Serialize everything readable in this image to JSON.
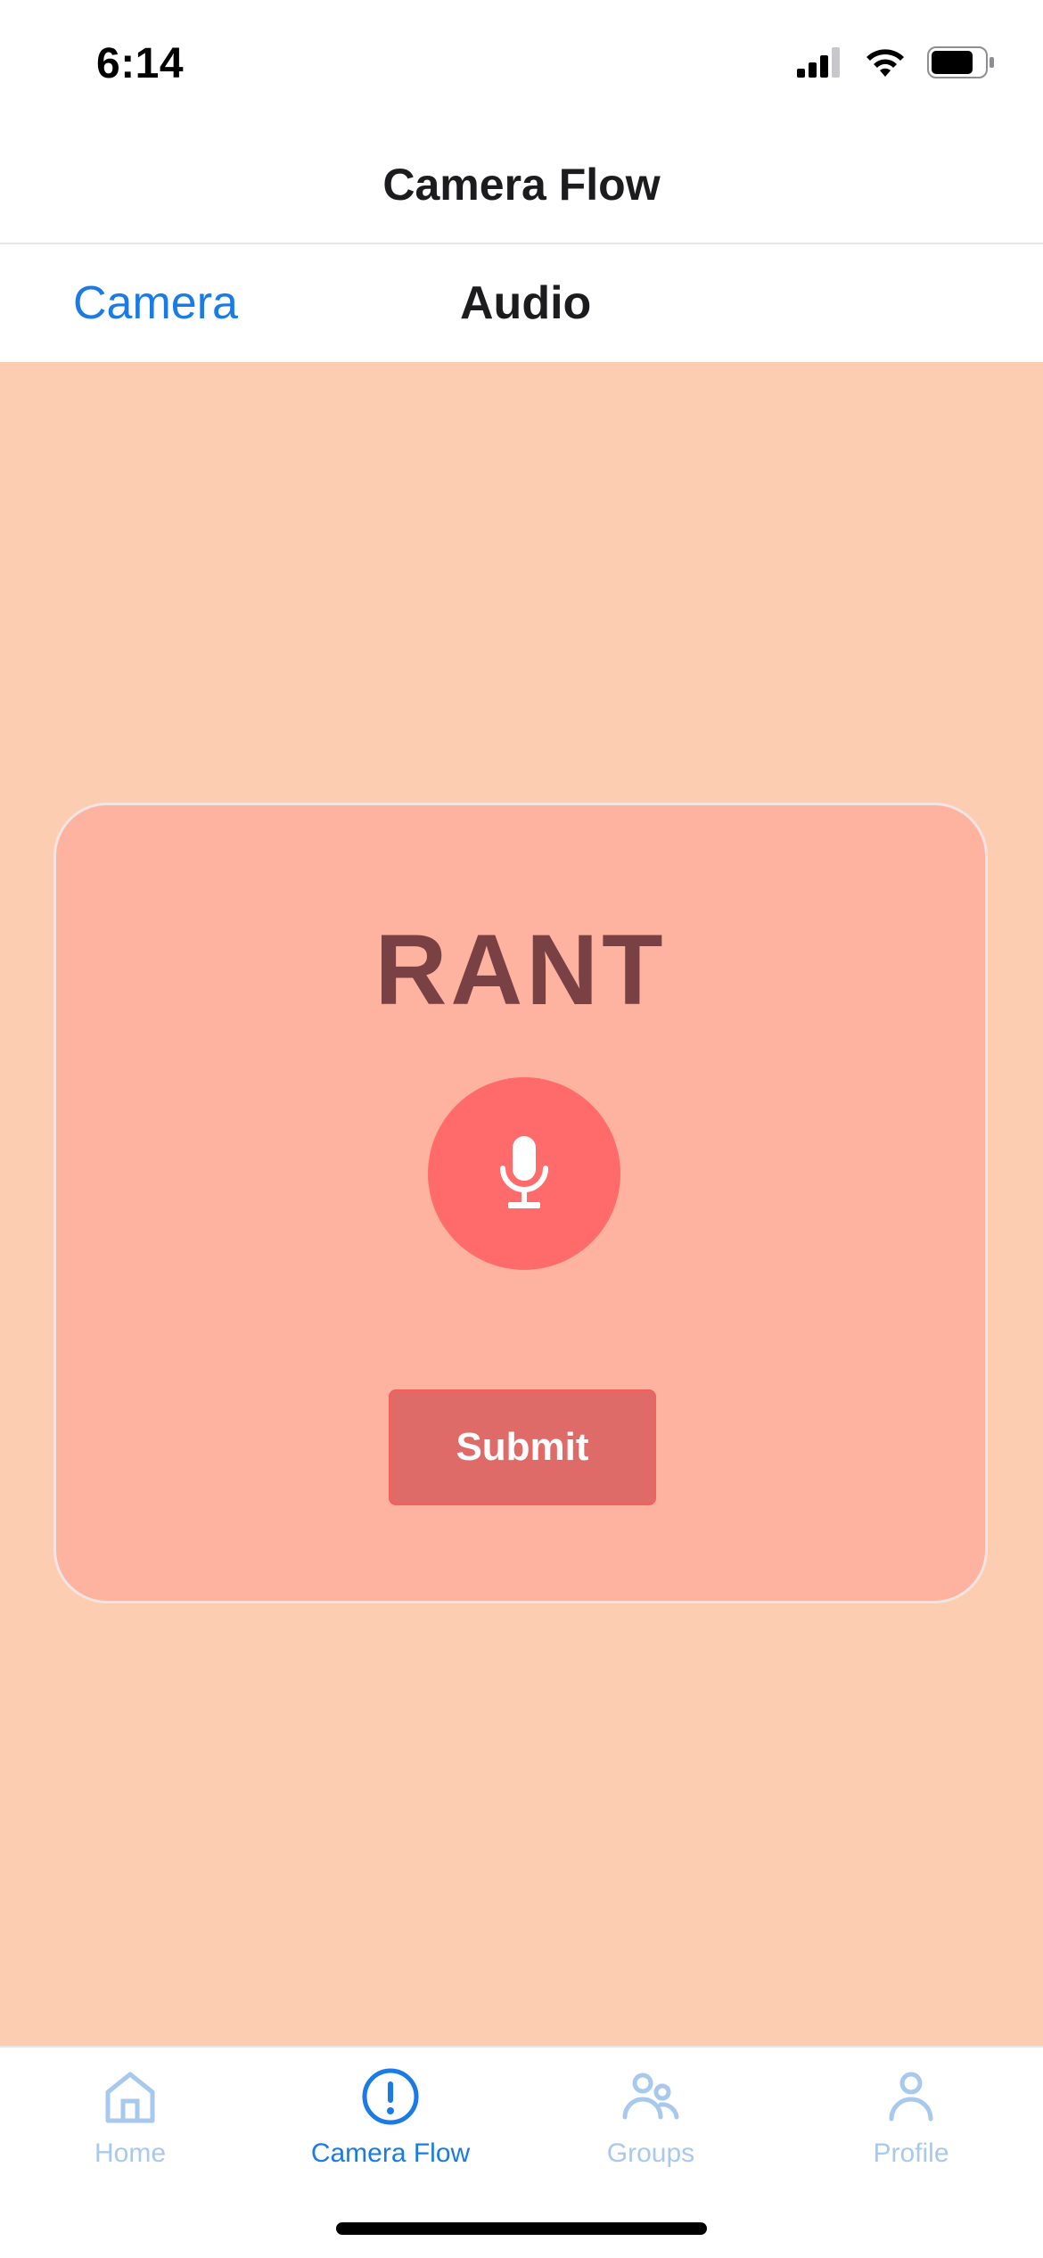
{
  "status_bar": {
    "time": "6:14"
  },
  "header": {
    "title": "Camera Flow"
  },
  "tabs": [
    {
      "label": "Camera",
      "active": false
    },
    {
      "label": "Audio",
      "active": true
    }
  ],
  "card": {
    "title": "RANT",
    "mic_icon": "microphone-icon",
    "submit_label": "Submit"
  },
  "tab_bar": {
    "items": [
      {
        "label": "Home",
        "icon": "home-icon",
        "active": false
      },
      {
        "label": "Camera Flow",
        "icon": "exclamation-circle-icon",
        "active": true
      },
      {
        "label": "Groups",
        "icon": "groups-icon",
        "active": false
      },
      {
        "label": "Profile",
        "icon": "profile-icon",
        "active": false
      }
    ]
  },
  "colors": {
    "accent": "#1a7ae6",
    "background": "#fdcdb2",
    "card": "#fdb3a0",
    "mic_button": "#ff6b6b",
    "submit_button": "#df6b68",
    "title_text": "#7a4145"
  }
}
